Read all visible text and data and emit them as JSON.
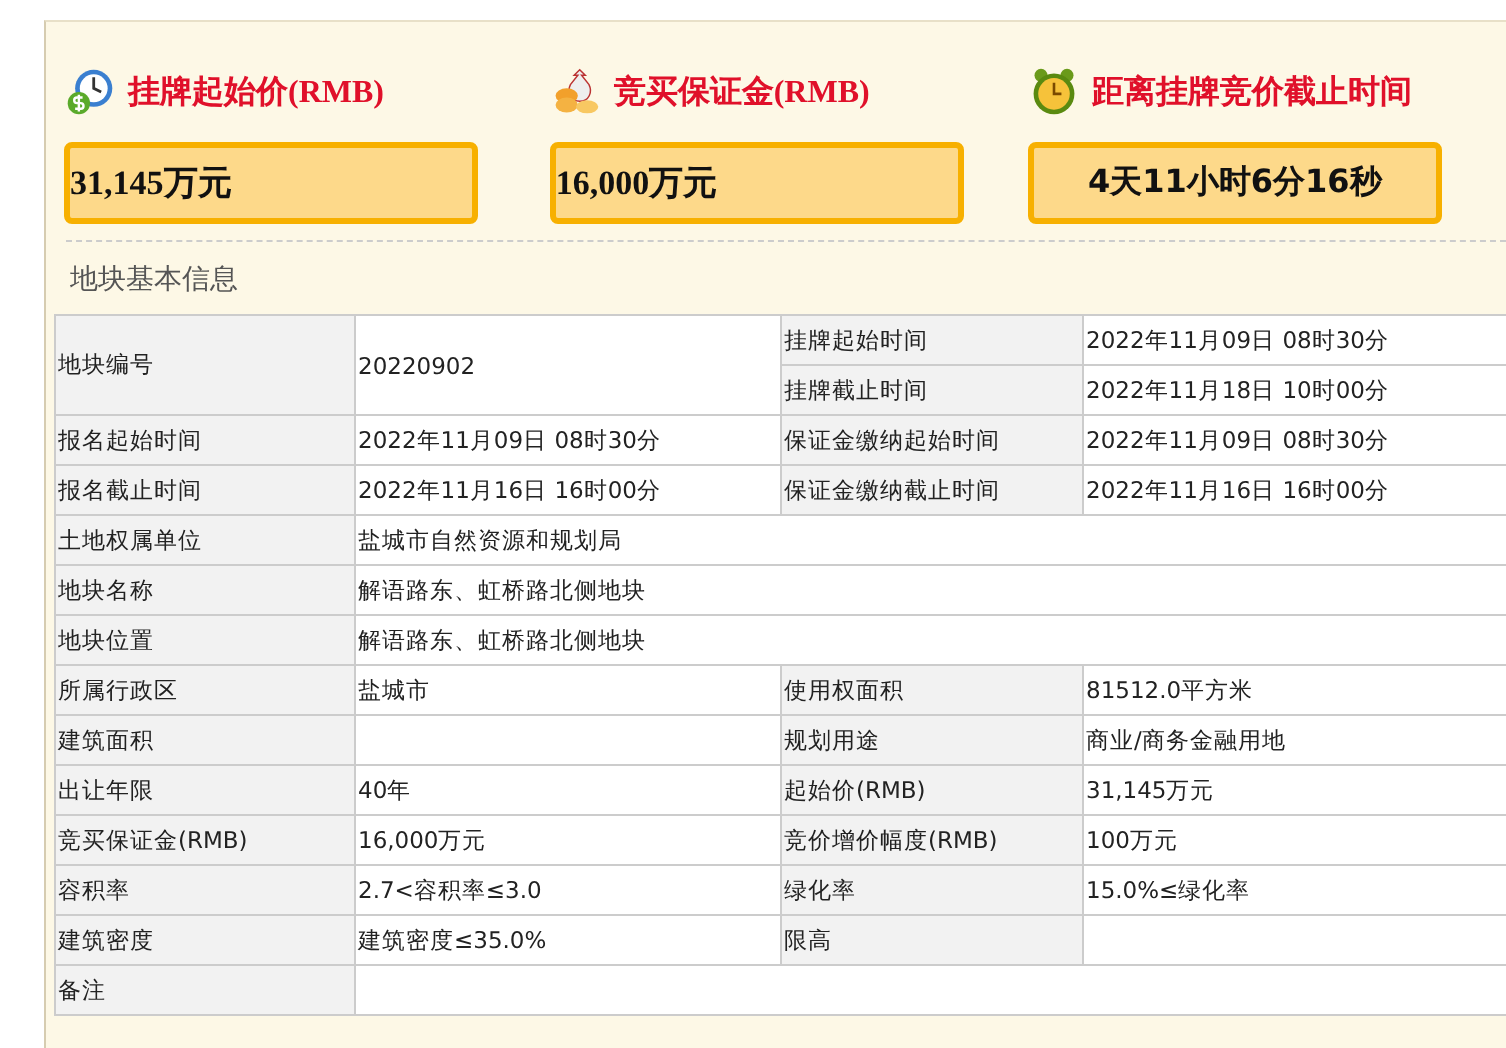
{
  "summary": [
    {
      "title": "挂牌起始价(RMB)",
      "value": "31,145万元"
    },
    {
      "title": "竞买保证金(RMB)",
      "value": "16,000万元"
    },
    {
      "title": "距离挂牌竞价截止时间",
      "value": "4天11小时6分16秒"
    }
  ],
  "section_title": "地块基本信息",
  "table": {
    "rows": [
      {
        "kind": "split",
        "label": "地块编号",
        "value": "20220902",
        "right": [
          {
            "label": "挂牌起始时间",
            "value": "2022年11月09日 08时30分"
          },
          {
            "label": "挂牌截止时间",
            "value": "2022年11月18日 10时00分"
          }
        ]
      },
      {
        "kind": "pair",
        "label": "报名起始时间",
        "value": "2022年11月09日 08时30分",
        "label2": "保证金缴纳起始时间",
        "value2": "2022年11月09日 08时30分"
      },
      {
        "kind": "pair",
        "label": "报名截止时间",
        "value": "2022年11月16日 16时00分",
        "label2": "保证金缴纳截止时间",
        "value2": "2022年11月16日 16时00分"
      },
      {
        "kind": "wide",
        "label": "土地权属单位",
        "value": "盐城市自然资源和规划局"
      },
      {
        "kind": "wide",
        "label": "地块名称",
        "value": "解语路东、虹桥路北侧地块"
      },
      {
        "kind": "wide",
        "label": "地块位置",
        "value": "解语路东、虹桥路北侧地块"
      },
      {
        "kind": "pair",
        "label": "所属行政区",
        "value": "盐城市",
        "label2": "使用权面积",
        "value2": "81512.0平方米"
      },
      {
        "kind": "pair",
        "label": "建筑面积",
        "label2": "规划用途",
        "value2": "商业/商务金融用地"
      },
      {
        "kind": "pair",
        "label": "出让年限",
        "value": "40年",
        "label2": "起始价(RMB)",
        "value2": "31,145万元"
      },
      {
        "kind": "pair",
        "label": "竞买保证金(RMB)",
        "value": "16,000万元",
        "label2": "竞价增价幅度(RMB)",
        "value2": "100万元"
      },
      {
        "kind": "pair",
        "label": "容积率",
        "value": "2.7<容积率≤3.0",
        "label2": "绿化率",
        "value2": "15.0%≤绿化率"
      },
      {
        "kind": "pair",
        "label": "建筑密度",
        "value": "建筑密度≤35.0%",
        "label2": "限高"
      },
      {
        "kind": "wide",
        "label": "备注"
      }
    ]
  }
}
